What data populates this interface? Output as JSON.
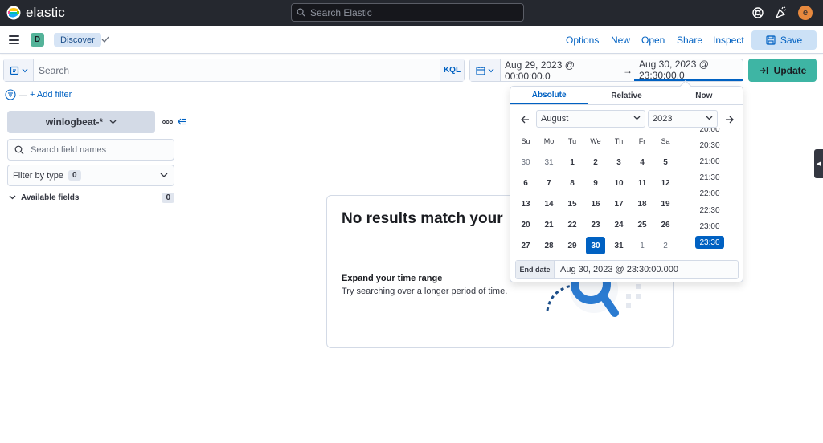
{
  "header": {
    "brand": "elastic",
    "search_placeholder": "Search Elastic",
    "icons": [
      "help-icon",
      "newsfeed-icon"
    ],
    "user_initial": "e",
    "colors": {
      "bg": "#25282f",
      "avatar": "#e7893e"
    }
  },
  "appbar": {
    "space_initial": "D",
    "breadcrumb": "Discover",
    "nav": [
      "Options",
      "New",
      "Open",
      "Share",
      "Inspect"
    ],
    "save_label": "Save"
  },
  "query": {
    "placeholder": "Search",
    "language": "KQL"
  },
  "datepicker": {
    "start": "Aug 29, 2023 @ 00:00:00.0",
    "arrow": "→",
    "end": "Aug 30, 2023 @ 23:30:00.0",
    "update_label": "Update"
  },
  "filters": {
    "add_label": "+ Add filter"
  },
  "sidebar": {
    "index_pattern": "winlogbeat-*",
    "field_search_placeholder": "Search field names",
    "filter_by_type": "Filter by type",
    "filter_count": "0",
    "available_fields": "Available fields",
    "available_count": "0"
  },
  "empty_state": {
    "title": "No results match your",
    "tip_title": "Expand your time range",
    "tip_text": "Try searching over a longer period of time."
  },
  "popover": {
    "tabs": [
      "Absolute",
      "Relative",
      "Now"
    ],
    "active_tab": "Absolute",
    "month": "August",
    "year": "2023",
    "weekdays": [
      "Su",
      "Mo",
      "Tu",
      "We",
      "Th",
      "Fr",
      "Sa"
    ],
    "weeks": [
      [
        "30",
        "31",
        "1",
        "2",
        "3",
        "4",
        "5"
      ],
      [
        "6",
        "7",
        "8",
        "9",
        "10",
        "11",
        "12"
      ],
      [
        "13",
        "14",
        "15",
        "16",
        "17",
        "18",
        "19"
      ],
      [
        "20",
        "21",
        "22",
        "23",
        "24",
        "25",
        "26"
      ],
      [
        "27",
        "28",
        "29",
        "30",
        "31",
        "1",
        "2"
      ]
    ],
    "selected_day": "30",
    "times": [
      "20:00",
      "20:30",
      "21:00",
      "21:30",
      "22:00",
      "22:30",
      "23:00",
      "23:30"
    ],
    "selected_time": "23:30",
    "end_label": "End date",
    "end_value": "Aug 30, 2023 @ 23:30:00.000",
    "accent": "#0061c2"
  }
}
